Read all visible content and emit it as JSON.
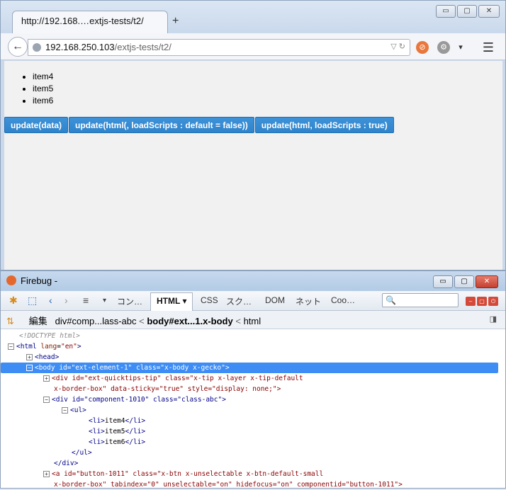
{
  "browser": {
    "tab_title": "http://192.168.…extjs-tests/t2/",
    "new_tab": "+",
    "url_host": "192.168.250.103",
    "url_path": "/extjs-tests/t2/",
    "window_buttons": [
      "▭",
      "▢",
      "✕"
    ]
  },
  "page": {
    "items": [
      "item4",
      "item5",
      "item6"
    ],
    "buttons": [
      "update(data)",
      "update(html(, loadScripts : default = false))",
      "update(html, loadScripts : true)"
    ]
  },
  "firebug": {
    "title": "Firebug -",
    "tabs": [
      "コン…",
      "HTML ▾",
      "CSS",
      "スク…",
      "DOM",
      "ネット",
      "Coo…"
    ],
    "search_icon": "🔍",
    "edit_label": "編集",
    "breadcrumb": [
      "div#comp...lass-abc",
      "body#ext...1.x-body",
      "html"
    ],
    "breadcrumb_sep": "<",
    "tree": {
      "doctype": "<!DOCTYPE html>",
      "html_open": "<html",
      "html_attr_name": "lang",
      "html_attr_val": "\"en\"",
      "head": "<head>",
      "body_line": "<body id=\"ext-element-1\" class=\"x-body x-gecko\">",
      "tip_line1": "<div id=\"ext-quicktips-tip\" class=\"x-tip x-layer x-tip-default",
      "tip_line2": "x-border-box\" data-sticky=\"true\" style=\"display: none;\">",
      "comp_line": "<div id=\"component-1010\" class=\"class-abc\">",
      "ul_open": "<ul>",
      "li_items": [
        "item4",
        "item5",
        "item6"
      ],
      "ul_close": "</ul>",
      "div_close": "</div>",
      "a_line1": "<a id=\"button-1011\" class=\"x-btn x-unselectable x-btn-default-small",
      "a_line2": "x-border-box\" tabindex=\"0\" unselectable=\"on\" hidefocus=\"on\" componentid=\"button-1011\">"
    }
  }
}
